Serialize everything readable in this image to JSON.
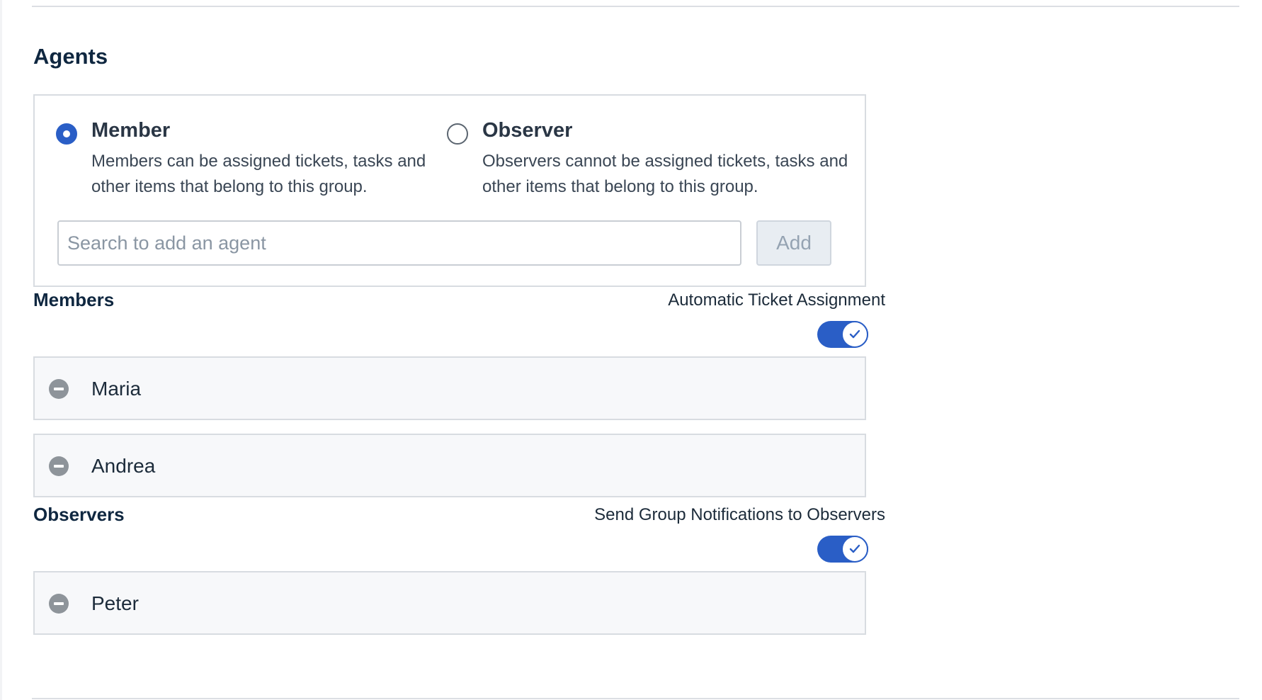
{
  "section": {
    "title": "Agents"
  },
  "roles": {
    "member": {
      "title": "Member",
      "description": "Members can be assigned tickets, tasks and other items that belong to this group.",
      "selected": true
    },
    "observer": {
      "title": "Observer",
      "description": "Observers cannot be assigned tickets, tasks and other items that belong to this group.",
      "selected": false
    }
  },
  "search": {
    "placeholder": "Search to add an agent",
    "value": ""
  },
  "add_button": {
    "label": "Add"
  },
  "members": {
    "title": "Members",
    "toggle_label": "Automatic Ticket Assignment",
    "toggle_on": true,
    "items": [
      {
        "name": "Maria"
      },
      {
        "name": "Andrea"
      }
    ]
  },
  "observers": {
    "title": "Observers",
    "toggle_label": "Send Group Notifications to Observers",
    "toggle_on": true,
    "items": [
      {
        "name": "Peter"
      }
    ]
  },
  "colors": {
    "accent": "#2a5ec6",
    "remove_icon": "#8e949a",
    "border": "#d8dce1"
  }
}
